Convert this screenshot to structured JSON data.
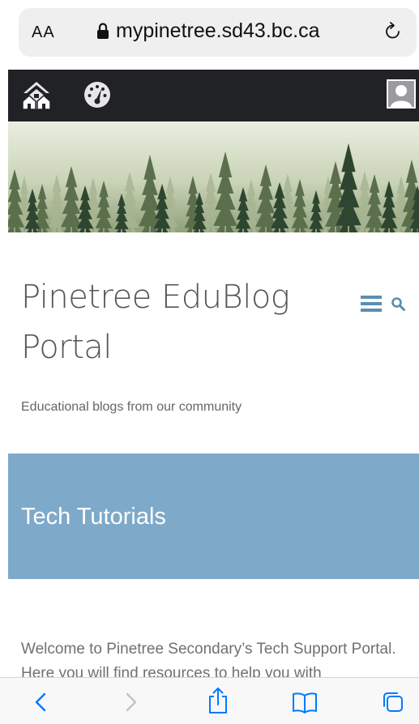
{
  "browser": {
    "text_size_label": "AA",
    "url": "mypinetree.sd43.bc.ca",
    "toolbar": {
      "back_icon": "chevron-left-icon",
      "forward_icon": "chevron-right-icon",
      "share_icon": "share-icon",
      "bookmarks_icon": "book-icon",
      "tabs_icon": "tabs-icon"
    }
  },
  "navbar": {
    "home_icon": "home-icon",
    "dashboard_icon": "dashboard-gauge-icon",
    "avatar_icon": "user-avatar-icon"
  },
  "site": {
    "title": "Pinetree EduBlog Portal",
    "tagline": "Educational blogs from our community",
    "menu_icon": "hamburger-menu-icon",
    "search_icon": "search-icon"
  },
  "section": {
    "title": "Tech Tutorials",
    "intro": "Welcome to Pinetree Secondary’s Tech Support Portal. Here you will find resources to help you with"
  },
  "colors": {
    "navbar_bg": "#212226",
    "band_bg": "#7ea9c9",
    "ios_blue": "#007aff"
  }
}
